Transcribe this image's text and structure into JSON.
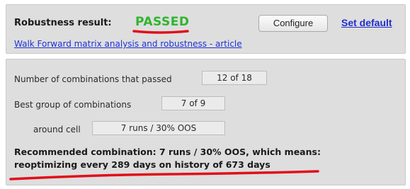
{
  "header": {
    "robustness_label": "Robustness result:",
    "robustness_status": "PASSED",
    "configure_button": "Configure",
    "set_default_link": "Set default",
    "article_link": "Walk Forward matrix analysis and robustness - article"
  },
  "stats": {
    "combinations_passed_label": "Number of combinations that passed",
    "combinations_passed_value": "12 of 18",
    "best_group_label": "Best group of combinations",
    "best_group_value": "7 of 9",
    "around_cell_label": "around cell",
    "around_cell_value": "7 runs / 30% OOS"
  },
  "recommendation": {
    "line1": "Recommended combination: 7 runs / 30% OOS, which means:",
    "line2": "reoptimizing every 289 days on history of 673 days"
  },
  "colors": {
    "passed": "#2fb52f",
    "annotation": "#e0101a",
    "link": "#1f2ccf",
    "panel_bg": "#dedede"
  }
}
